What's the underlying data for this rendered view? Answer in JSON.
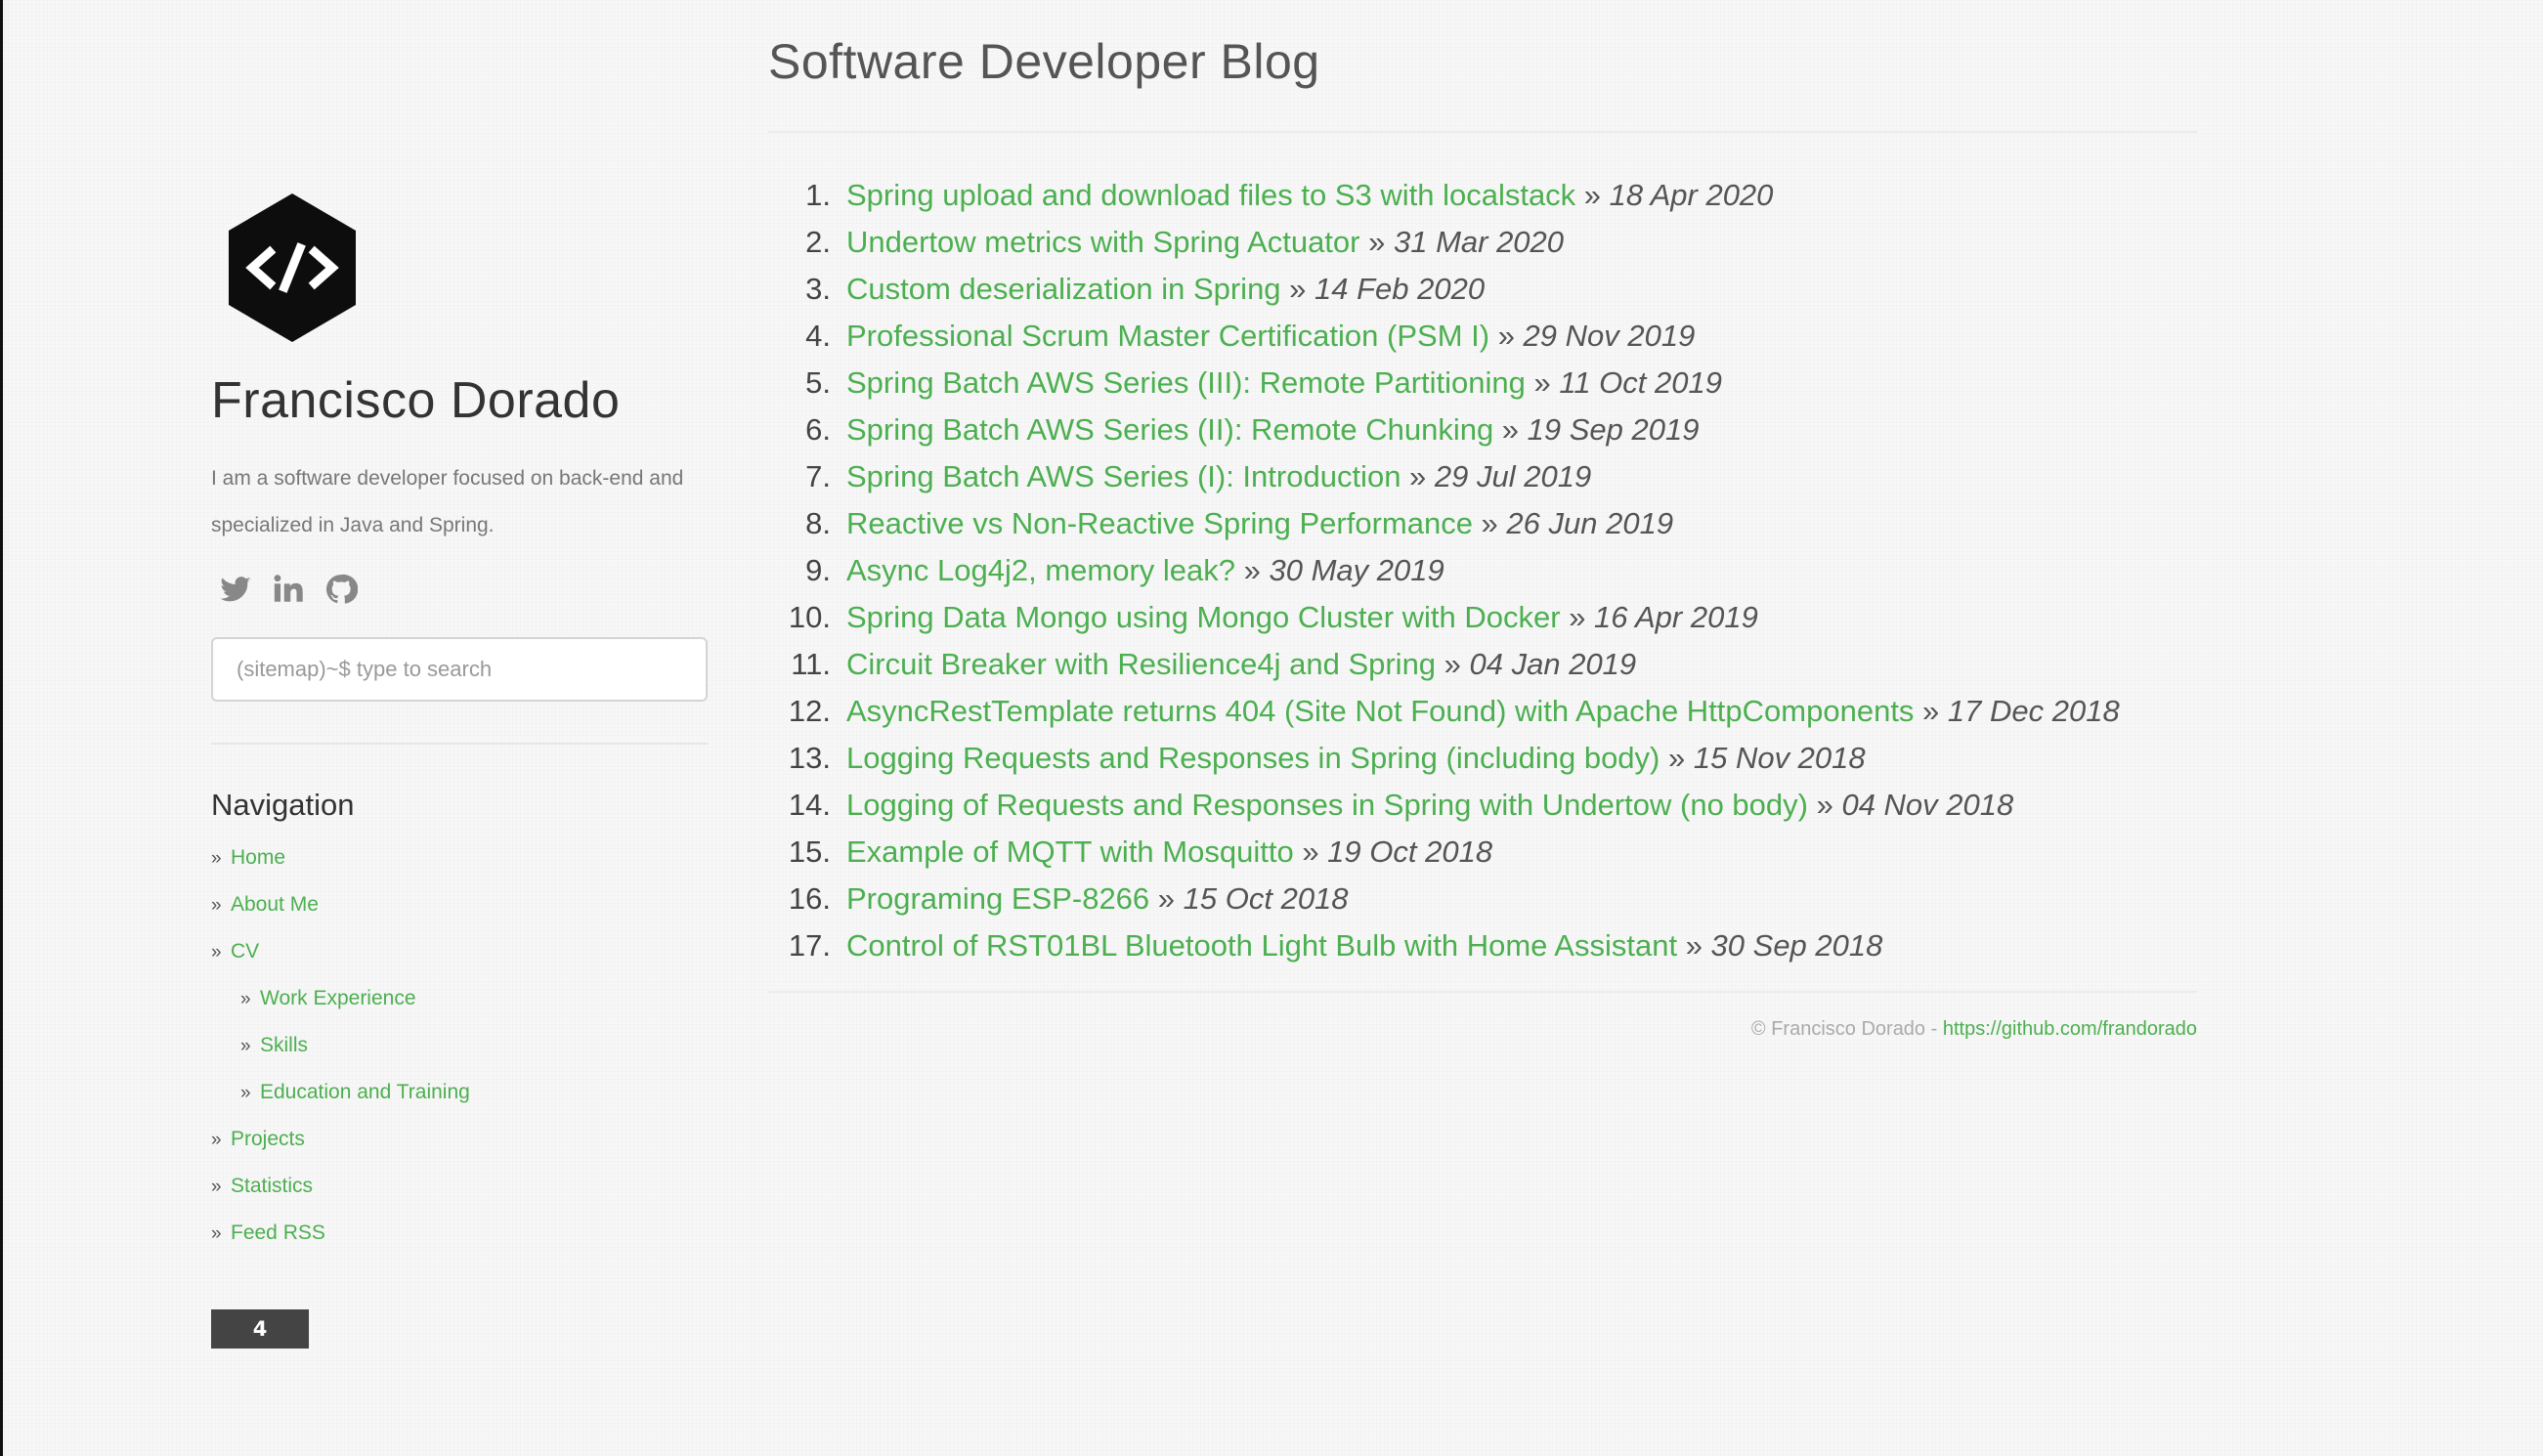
{
  "sidebar": {
    "author_name": "Francisco Dorado",
    "bio": "I am a software developer focused on back-end and specialized in Java and Spring.",
    "social": [
      {
        "icon": "twitter-icon"
      },
      {
        "icon": "linkedin-icon"
      },
      {
        "icon": "github-icon"
      }
    ],
    "search": {
      "placeholder": "(sitemap)~$ type to search",
      "value": ""
    },
    "nav_heading": "Navigation",
    "nav_items": [
      {
        "label": "Home",
        "level": 0
      },
      {
        "label": "About Me",
        "level": 0
      },
      {
        "label": "CV",
        "level": 0
      },
      {
        "label": "Work Experience",
        "level": 1
      },
      {
        "label": "Skills",
        "level": 1
      },
      {
        "label": "Education and Training",
        "level": 1
      },
      {
        "label": "Projects",
        "level": 0
      },
      {
        "label": "Statistics",
        "level": 0
      },
      {
        "label": "Feed RSS",
        "level": 0
      }
    ],
    "visitor_count": "4"
  },
  "main": {
    "title": "Software Developer Blog",
    "posts": [
      {
        "num": "1.",
        "title": "Spring upload and download files to S3 with localstack",
        "date": "18 Apr 2020"
      },
      {
        "num": "2.",
        "title": "Undertow metrics with Spring Actuator",
        "date": "31 Mar 2020"
      },
      {
        "num": "3.",
        "title": "Custom deserialization in Spring",
        "date": "14 Feb 2020"
      },
      {
        "num": "4.",
        "title": "Professional Scrum Master Certification (PSM I)",
        "date": "29 Nov 2019"
      },
      {
        "num": "5.",
        "title": "Spring Batch AWS Series (III): Remote Partitioning",
        "date": "11 Oct 2019"
      },
      {
        "num": "6.",
        "title": "Spring Batch AWS Series (II): Remote Chunking",
        "date": "19 Sep 2019"
      },
      {
        "num": "7.",
        "title": "Spring Batch AWS Series (I): Introduction",
        "date": "29 Jul 2019"
      },
      {
        "num": "8.",
        "title": "Reactive vs Non-Reactive Spring Performance",
        "date": "26 Jun 2019"
      },
      {
        "num": "9.",
        "title": "Async Log4j2, memory leak?",
        "date": "30 May 2019"
      },
      {
        "num": "10.",
        "title": "Spring Data Mongo using Mongo Cluster with Docker",
        "date": "16 Apr 2019"
      },
      {
        "num": "11.",
        "title": "Circuit Breaker with Resilience4j and Spring",
        "date": "04 Jan 2019"
      },
      {
        "num": "12.",
        "title": "AsyncRestTemplate returns 404 (Site Not Found) with Apache HttpComponents",
        "date": "17 Dec 2018"
      },
      {
        "num": "13.",
        "title": "Logging Requests and Responses in Spring (including body)",
        "date": "15 Nov 2018"
      },
      {
        "num": "14.",
        "title": "Logging of Requests and Responses in Spring with Undertow (no body)",
        "date": "04 Nov 2018"
      },
      {
        "num": "15.",
        "title": "Example of MQTT with Mosquitto",
        "date": "19 Oct 2018"
      },
      {
        "num": "16.",
        "title": "Programing ESP-8266",
        "date": "15 Oct 2018"
      },
      {
        "num": "17.",
        "title": "Control of RST01BL Bluetooth Light Bulb with Home Assistant",
        "date": "30 Sep 2018"
      }
    ],
    "separator": "»",
    "footer": {
      "copyright": "© Francisco Dorado - ",
      "link": "https://github.com/frandorado"
    }
  },
  "colors": {
    "link": "#4caf50",
    "text": "#555555",
    "badge": "#444444"
  }
}
